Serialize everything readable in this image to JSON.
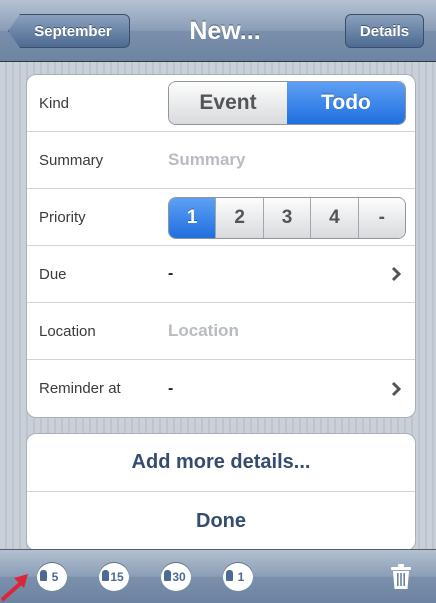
{
  "navbar": {
    "back_label": "September",
    "title": "New...",
    "details_label": "Details"
  },
  "form": {
    "kind": {
      "label": "Kind",
      "options": [
        "Event",
        "Todo"
      ],
      "selected": "Todo"
    },
    "summary": {
      "label": "Summary",
      "placeholder": "Summary"
    },
    "priority": {
      "label": "Priority",
      "options": [
        "1",
        "2",
        "3",
        "4",
        "-"
      ],
      "selected": "1"
    },
    "due": {
      "label": "Due",
      "value": "-"
    },
    "location": {
      "label": "Location",
      "placeholder": "Location"
    },
    "reminder": {
      "label": "Reminder at",
      "value": "-"
    }
  },
  "actions": {
    "add_more": "Add more details...",
    "done": "Done"
  },
  "toolbar": {
    "reminders": [
      "5",
      "15",
      "30",
      "1"
    ],
    "trash_icon": "trash-icon"
  },
  "colors": {
    "accent_blue": "#1f6fe0",
    "nav_blue": "#6d84a2",
    "action_text": "#354c71"
  }
}
